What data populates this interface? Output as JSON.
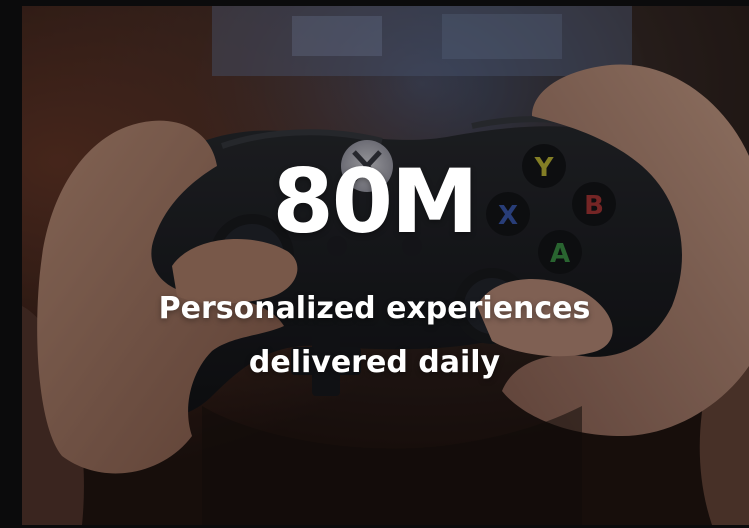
{
  "stat": {
    "value": "80M",
    "line1": "Personalized experiences",
    "line2": "delivered daily"
  },
  "colors": {
    "text": "#ffffff",
    "overlay": "rgba(0,0,0,0.35)",
    "background": "#0b0b0c"
  },
  "photo": {
    "subject": "hands-holding-game-controller",
    "icon": "xbox-controller-icon"
  }
}
